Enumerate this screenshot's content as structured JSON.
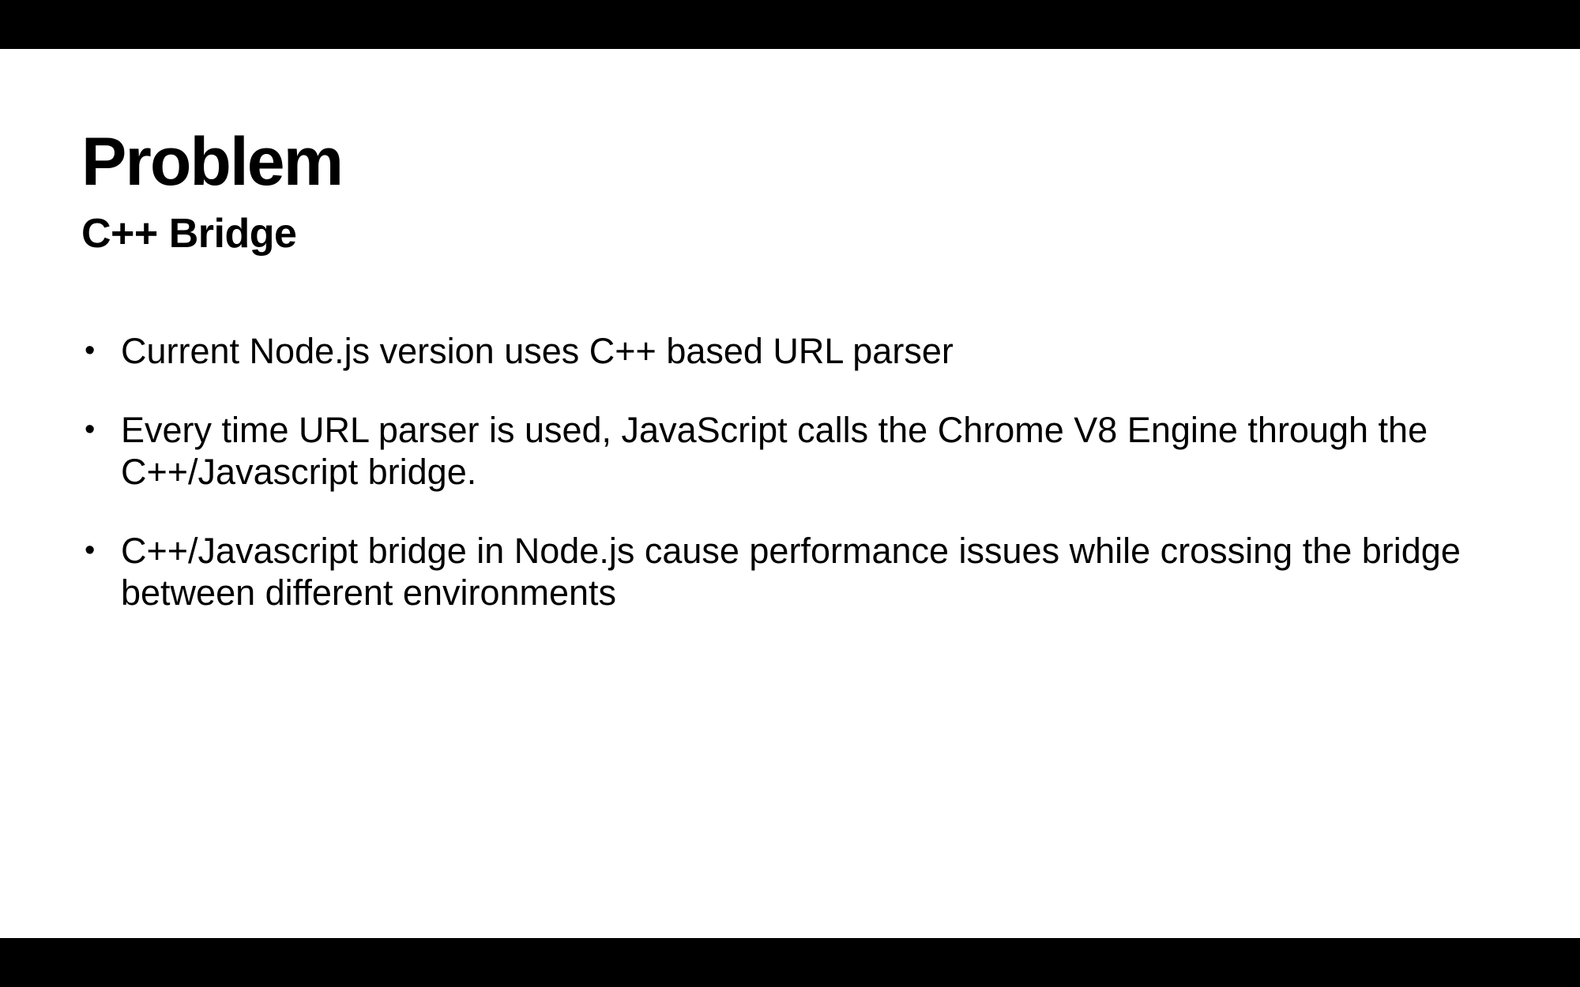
{
  "slide": {
    "title": "Problem",
    "subtitle": "C++ Bridge",
    "bullet_symbol": "•",
    "bullets": [
      "Current Node.js version uses C++ based URL parser",
      "Every time URL parser is used, JavaScript calls the Chrome V8 Engine through the C++/Javascript bridge.",
      "C++/Javascript bridge in Node.js cause performance issues while crossing the bridge between different environments"
    ]
  },
  "colors": {
    "letterbox": "#000000",
    "slide_background": "#ffffff",
    "text": "#000000"
  }
}
